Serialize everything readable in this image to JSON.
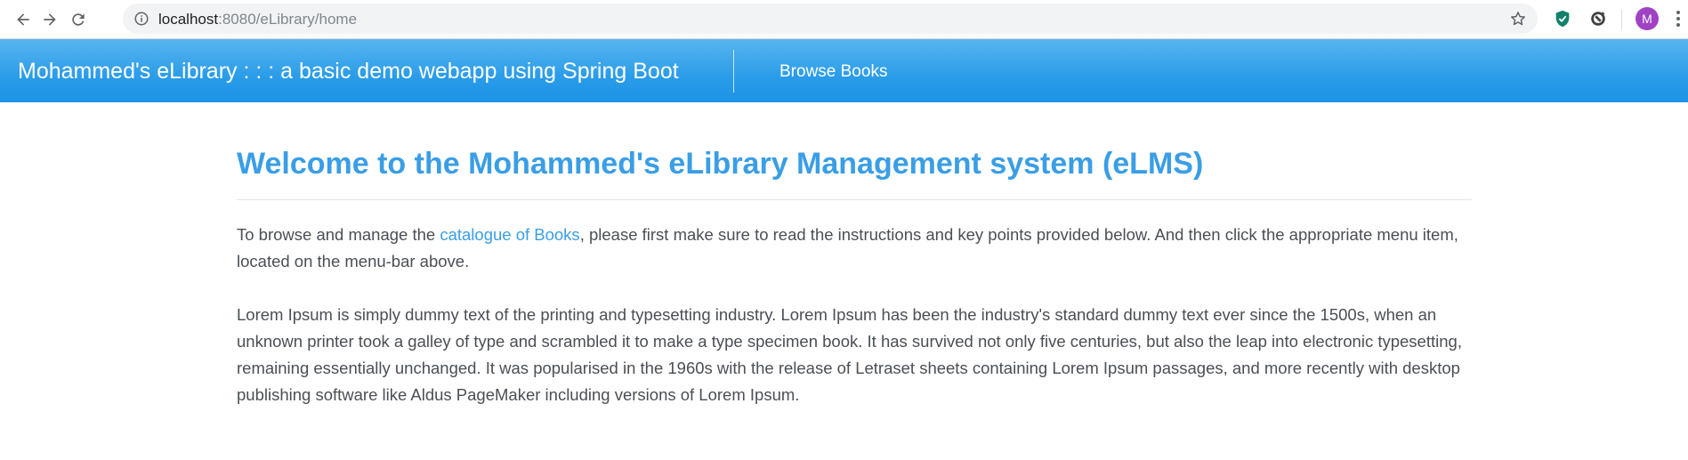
{
  "browser": {
    "url_host": "localhost",
    "url_path": ":8080/eLibrary/home"
  },
  "navbar": {
    "brand": "Mohammed's eLibrary : : : a basic demo webapp using Spring Boot",
    "link_browse": "Browse Books"
  },
  "main": {
    "title": "Welcome to the Mohammed's eLibrary Management system (eLMS)",
    "intro_before": "To browse and manage the ",
    "intro_link": "catalogue of Books",
    "intro_after": ", please first make sure to read the instructions and key points provided below. And then click the appropriate menu item, located on the menu-bar above.",
    "lorem": "Lorem Ipsum is simply dummy text of the printing and typesetting industry. Lorem Ipsum has been the industry's standard dummy text ever since the 1500s, when an unknown printer took a galley of type and scrambled it to make a type specimen book. It has survived not only five centuries, but also the leap into electronic typesetting, remaining essentially unchanged. It was popularised in the 1960s with the release of Letraset sheets containing Lorem Ipsum passages, and more recently with desktop publishing software like Aldus PageMaker including versions of Lorem Ipsum."
  },
  "user": {
    "avatar_initial": "M"
  },
  "colors": {
    "navbar": "#2a9ce9",
    "accent": "#3a9ee6",
    "avatar": "#a142c4"
  },
  "icons": [
    "back-icon",
    "forward-icon",
    "reload-icon",
    "info-icon",
    "star-icon",
    "shield-extension-icon",
    "sync-extension-icon",
    "menu-kebab-icon"
  ]
}
